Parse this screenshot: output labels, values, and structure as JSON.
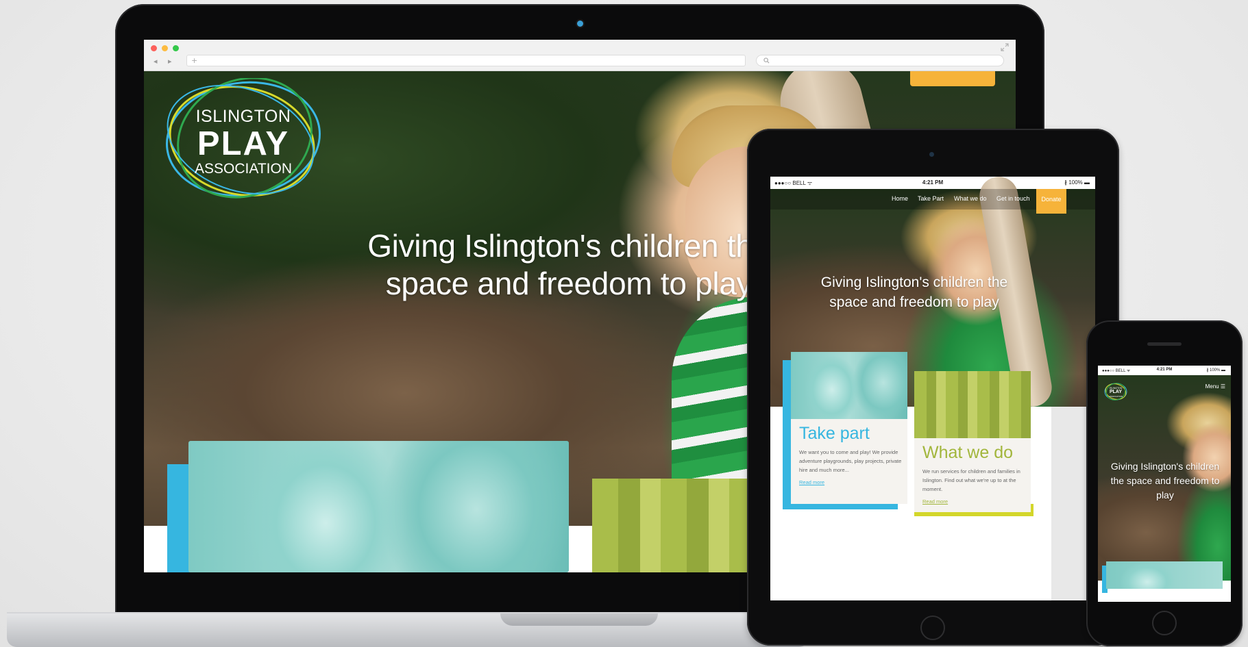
{
  "colors": {
    "accent_blue": "#36b6e0",
    "accent_lime": "#d3d62a",
    "donate_orange": "#f6b33a",
    "take_part_title": "#36b6e0",
    "what_we_do_title": "#a2b63c"
  },
  "logo": {
    "line1": "ISLINGTON",
    "line2": "PLAY",
    "line3": "ASSOCIATION"
  },
  "laptop": {
    "browser": {
      "nav_arrows": "◂ ▸",
      "new_tab": "+",
      "search_icon": "search-icon",
      "expand_icon": "expand-icon"
    },
    "hero_headline": "Giving Islington's children the space and freedom to play"
  },
  "tablet": {
    "status": {
      "carrier": "●●●○○ BELL ᯤ",
      "time": "4:21 PM",
      "battery": "∦ 100% ▬"
    },
    "nav": {
      "home": "Home",
      "take_part": "Take Part",
      "what_we_do": "What we do",
      "get_in_touch": "Get in touch",
      "donate": "Donate"
    },
    "hero_headline": "Giving Islington's children the space and freedom to play",
    "cards": {
      "take_part": {
        "title": "Take part",
        "body": "We want you to come and play! We provide adventure playgrounds, play projects, private hire and much more...",
        "link": "Read more"
      },
      "what_we_do": {
        "title": "What we do",
        "body": "We run services for children and families in Islington. Find out what we're up to at the moment.",
        "link": "Read more"
      }
    }
  },
  "phone": {
    "status": {
      "carrier": "●●●○○ BELL ᯤ",
      "time": "4:21 PM",
      "battery": "∦ 100% ▬"
    },
    "logo": {
      "line1": "ISLINGTON",
      "line2": "PLAY",
      "line3": "ASSOCIATION"
    },
    "menu_label": "Menu ☰",
    "hero_headline": "Giving Islington's children the space and freedom to play"
  }
}
